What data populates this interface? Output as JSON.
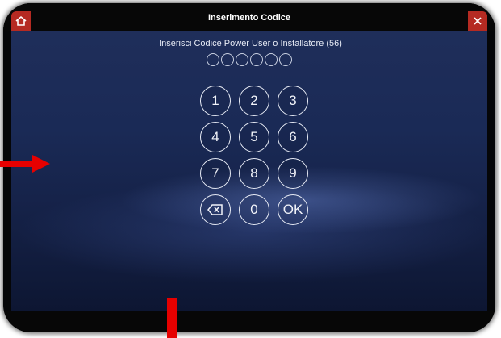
{
  "header": {
    "title": "Inserimento Codice"
  },
  "prompt": {
    "text": "Inserisci Codice Power User o Installatore (56)"
  },
  "code_dots": {
    "count": 6,
    "filled": 0
  },
  "keypad": {
    "keys": [
      "1",
      "2",
      "3",
      "4",
      "5",
      "6",
      "7",
      "8",
      "9",
      "",
      "0",
      "OK"
    ]
  },
  "colors": {
    "accent": "#b52a22",
    "annotation": "#e60000"
  },
  "icons": [
    "home-icon",
    "close-icon",
    "backspace-icon"
  ]
}
